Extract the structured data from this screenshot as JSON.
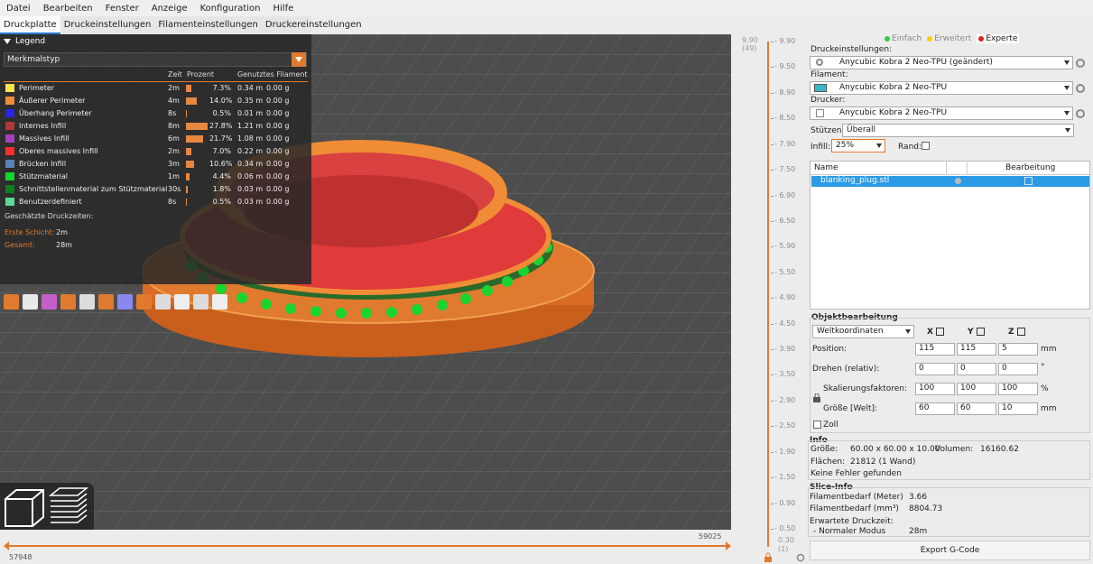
{
  "menu": [
    "Datei",
    "Bearbeiten",
    "Fenster",
    "Anzeige",
    "Konfiguration",
    "Hilfe"
  ],
  "tabs": [
    "Druckplatte",
    "Druckeinstellungen",
    "Filamenteinstellungen",
    "Druckereinstellungen"
  ],
  "legend": {
    "title": "Legend",
    "combo": "Merkmalstyp",
    "col_time": "Zeit",
    "col_pct": "Prozent",
    "col_fil": "Genutztes Filament",
    "rows": [
      {
        "name": "Perimeter",
        "time": "2m",
        "pct": "7.3%",
        "m": "0.34 m",
        "g": "0.00 g",
        "color": "#ffe34d",
        "frac": 0.073
      },
      {
        "name": "Äußerer Perimeter",
        "time": "4m",
        "pct": "14.0%",
        "m": "0.35 m",
        "g": "0.00 g",
        "color": "#f08c35",
        "frac": 0.14
      },
      {
        "name": "Überhang Perimeter",
        "time": "8s",
        "pct": "0.5%",
        "m": "0.01 m",
        "g": "0.00 g",
        "color": "#2b24e0",
        "frac": 0.005
      },
      {
        "name": "Internes Infill",
        "time": "8m",
        "pct": "27.8%",
        "m": "1.21 m",
        "g": "0.00 g",
        "color": "#b23838",
        "frac": 0.278
      },
      {
        "name": "Massives Infill",
        "time": "6m",
        "pct": "21.7%",
        "m": "1.08 m",
        "g": "0.00 g",
        "color": "#a53fbf",
        "frac": 0.217
      },
      {
        "name": "Oberes massives Infill",
        "time": "2m",
        "pct": "7.0%",
        "m": "0.22 m",
        "g": "0.00 g",
        "color": "#ff2e2e",
        "frac": 0.07
      },
      {
        "name": "Brücken Infill",
        "time": "3m",
        "pct": "10.6%",
        "m": "0.34 m",
        "g": "0.00 g",
        "color": "#5c82b8",
        "frac": 0.106
      },
      {
        "name": "Stützmaterial",
        "time": "1m",
        "pct": "4.4%",
        "m": "0.06 m",
        "g": "0.00 g",
        "color": "#12d62e",
        "frac": 0.044
      },
      {
        "name": "Schnittstellenmaterial zum Stützmaterial",
        "time": "30s",
        "pct": "1.8%",
        "m": "0.03 m",
        "g": "0.00 g",
        "color": "#0e7f1e",
        "frac": 0.018
      },
      {
        "name": "Benutzerdefiniert",
        "time": "8s",
        "pct": "0.5%",
        "m": "0.03 m",
        "g": "0.00 g",
        "color": "#5ed89a",
        "frac": 0.005
      }
    ],
    "est_label": "Geschätzte Druckzeiten:",
    "first_label": "Erste Schicht:",
    "first_val": "2m",
    "total_label": "Gesamt:",
    "total_val": "28m"
  },
  "hslider": {
    "left": "57948",
    "right": "59025"
  },
  "vslider": {
    "top_val": "9.90",
    "top_layer": "(49)",
    "bottom_val": "0.30",
    "bottom_layer": "(1)",
    "ticks": [
      "9.90",
      "9.50",
      "8.90",
      "8.50",
      "7.90",
      "7.50",
      "6.90",
      "6.50",
      "5.90",
      "5.50",
      "4.90",
      "4.50",
      "3.90",
      "3.50",
      "2.90",
      "2.50",
      "1.90",
      "1.50",
      "0.90",
      "0.50"
    ]
  },
  "sidebar": {
    "modes": [
      {
        "label": "Einfach",
        "color": "#2ecc40"
      },
      {
        "label": "Erweitert",
        "color": "#f5d000"
      },
      {
        "label": "Experte",
        "color": "#e02020"
      }
    ],
    "print_label": "Druckeinstellungen:",
    "print_value": "Anycubic Kobra 2 Neo-TPU (geändert)",
    "filament_label": "Filament:",
    "filament_value": "Anycubic Kobra 2 Neo-TPU",
    "printer_label": "Drucker:",
    "printer_value": "Anycubic Kobra 2 Neo-TPU",
    "support_label": "Stützen:",
    "support_value": "Überall",
    "infill_label": "Infill:",
    "infill_value": "25%",
    "brim_label": "Rand:",
    "col_name": "Name",
    "col_edit": "Bearbeitung",
    "object_name": "blanking_plug.stl",
    "obj_title": "Objektbearbeitung",
    "coords": "Weltkoordinaten",
    "x": "X",
    "y": "Y",
    "z": "Z",
    "position_label": "Position:",
    "pos": [
      "115",
      "115",
      "5"
    ],
    "pos_unit": "mm",
    "rotate_label": "Drehen (relativ):",
    "rot": [
      "0",
      "0",
      "0"
    ],
    "rot_unit": "°",
    "scale_label": "Skalierungsfaktoren:",
    "scale": [
      "100",
      "100",
      "100"
    ],
    "scale_unit": "%",
    "size_label": "Größe [Welt]:",
    "size": [
      "60",
      "60",
      "10"
    ],
    "size_unit": "mm",
    "inch_label": "Zoll",
    "info_title": "Info",
    "size_info_label": "Größe:",
    "size_info": "60.00 x 60.00 x 10.00",
    "volume_label": "Volumen:",
    "volume": "16160.62",
    "faces_label": "Flächen:",
    "faces": "21812 (1 Wand)",
    "errors": "Keine Fehler gefunden",
    "slice_title": "Slice-Info",
    "fil_m_label": "Filamentbedarf (Meter)",
    "fil_m": "3.66",
    "fil_mm3_label": "Filamentbedarf (mm³)",
    "fil_mm3": "8804.73",
    "est_time_label": "Erwartete Druckzeit:",
    "normal_label": "- Normaler Modus",
    "normal_val": "28m",
    "export": "Export G-Code"
  }
}
